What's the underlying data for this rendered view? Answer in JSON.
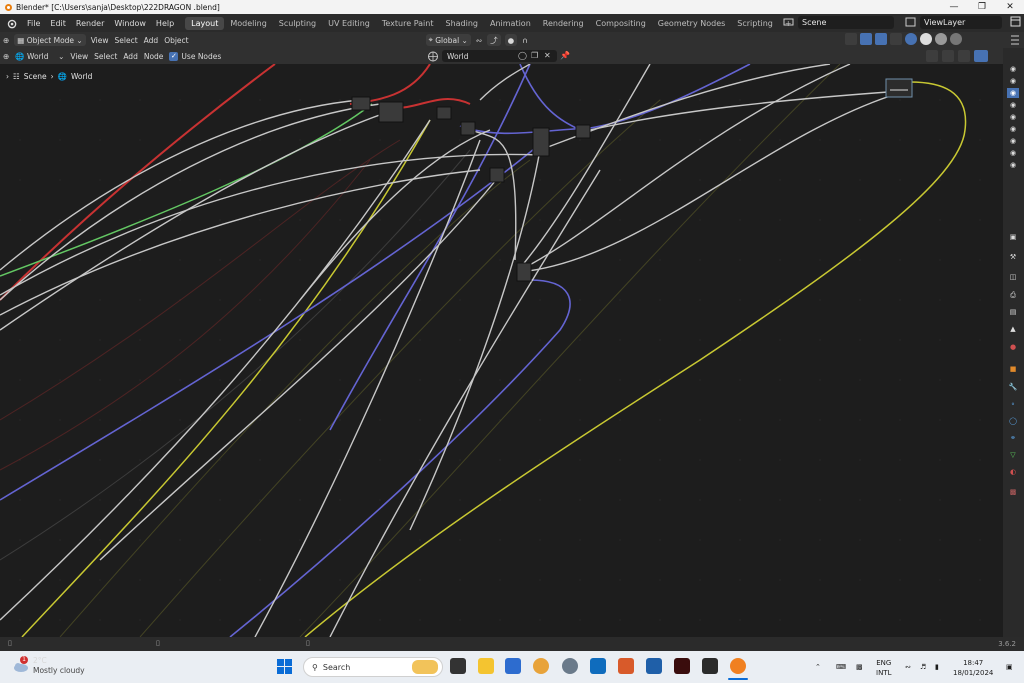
{
  "window": {
    "title": "Blender* [C:\\Users\\sanja\\Desktop\\222DRAGON .blend]"
  },
  "menu": {
    "file": "File",
    "edit": "Edit",
    "render": "Render",
    "window": "Window",
    "help": "Help"
  },
  "workspace_tabs": [
    "Layout",
    "Modeling",
    "Sculpting",
    "UV Editing",
    "Texture Paint",
    "Shading",
    "Animation",
    "Rendering",
    "Compositing",
    "Geometry Nodes",
    "Scripting",
    "+"
  ],
  "active_tab": "Layout",
  "scene": {
    "name": "Scene",
    "view_layer": "ViewLayer"
  },
  "toolbar": {
    "mode": "Object Mode",
    "view": "View",
    "select": "Select",
    "add": "Add",
    "object": "Object",
    "orientation": "Global"
  },
  "node_header": {
    "shader_type": "World",
    "view": "View",
    "select": "Select",
    "add": "Add",
    "node": "Node",
    "use_nodes": "Use Nodes",
    "world_name": "World"
  },
  "breadcrumb": {
    "scene": "Scene",
    "world": "World"
  },
  "version": "3.6.2",
  "colors": {
    "accent": "#4772b3",
    "active_tab": "#474747",
    "wire_yellow": "#c8c832",
    "wire_purple": "#6464d2",
    "wire_red": "#c83232",
    "wire_green": "#63c763",
    "wire_gray": "#c7c7c7"
  },
  "taskbar": {
    "weather_temp": "2°C",
    "weather_text": "Mostly cloudy",
    "search_placeholder": "Search",
    "lang_top": "ENG",
    "lang_bottom": "INTL",
    "time": "18:47",
    "date": "18/01/2024",
    "notif_badge": "1"
  }
}
